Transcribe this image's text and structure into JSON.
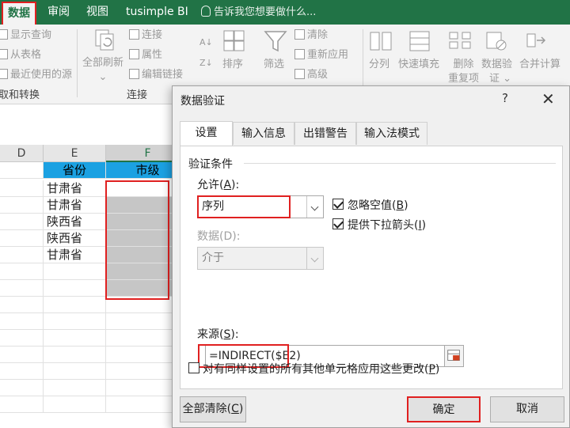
{
  "ribbon_tabs": {
    "data": "数据",
    "review": "审阅",
    "view": "视图",
    "bi": "tusimple BI",
    "tell_me": "告诉我您想要做什么..."
  },
  "ribbon": {
    "show_query": "显示查询",
    "from_table": "从表格",
    "recent_sources": "最近使用的源",
    "get_transform_group": "取和转换",
    "refresh_all_line1": "全部刷新",
    "refresh_all_arrow": "⌄",
    "connections": "连接",
    "properties": "属性",
    "edit_links": "编辑链接",
    "connections_group": "连接",
    "sort": "排序",
    "filter": "筛选",
    "clear": "清除",
    "reapply": "重新应用",
    "advanced": "高级",
    "text_to_columns": "分列",
    "flash_fill": "快速填充",
    "remove_duplicates_line1": "删除",
    "remove_duplicates_line2": "重复项",
    "data_validation_line1": "数据验",
    "data_validation_line2": "证 ⌄",
    "consolidate": "合并计算"
  },
  "sheet": {
    "columns": [
      "D",
      "E",
      "F"
    ],
    "header_row": [
      "",
      "省份",
      "市级"
    ],
    "rows": [
      [
        "",
        "甘肃省",
        ""
      ],
      [
        "",
        "甘肃省",
        ""
      ],
      [
        "",
        "陕西省",
        ""
      ],
      [
        "",
        "陕西省",
        ""
      ],
      [
        "",
        "甘肃省",
        ""
      ]
    ]
  },
  "dialog": {
    "title": "数据验证",
    "help": "?",
    "close": "✕",
    "tabs": [
      "设置",
      "输入信息",
      "出错警告",
      "输入法模式"
    ],
    "section_label": "验证条件",
    "allow_label": "允许(",
    "allow_key": "A",
    "allow_tail": "):",
    "allow_value": "序列",
    "ignore_blank_label": "忽略空值(",
    "ignore_blank_key": "B",
    "ignore_blank_tail": ")",
    "ignore_blank_checked": true,
    "dropdown_label": "提供下拉箭头(",
    "dropdown_key": "I",
    "dropdown_tail": ")",
    "dropdown_checked": true,
    "data_label": "数据(D):",
    "data_value": "介于",
    "source_label": "来源(",
    "source_key": "S",
    "source_tail": "):",
    "source_value": "=INDIRECT($E2)",
    "apply_all_label": "对有同样设置的所有其他单元格应用这些更改(",
    "apply_all_key": "P",
    "apply_all_tail": ")",
    "apply_all_checked": false,
    "clear_all_label": "全部清除(",
    "clear_all_key": "C",
    "clear_all_tail": ")",
    "ok_label": "确定",
    "cancel_label": "取消"
  },
  "colors": {
    "ribbon_green": "#217346",
    "header_fill": "#1ba1e2",
    "selection_fill": "#c6c6c6",
    "highlight_red": "#e02020"
  }
}
